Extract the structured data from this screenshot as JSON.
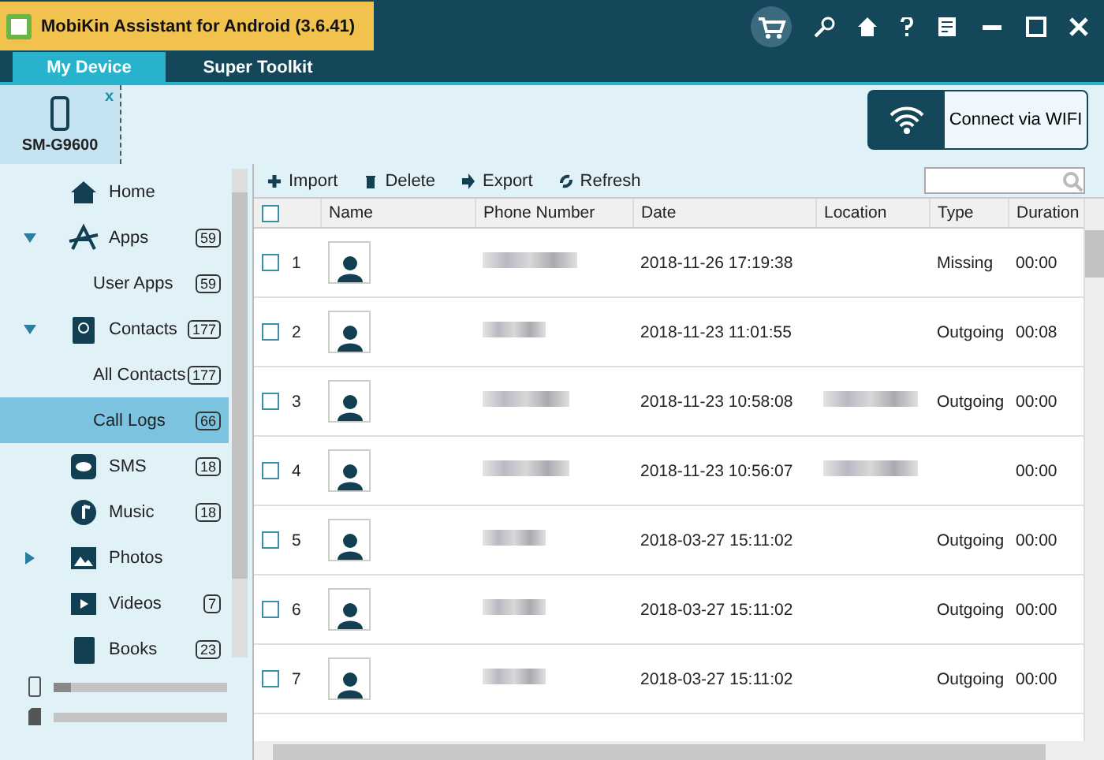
{
  "window": {
    "title": "MobiKin Assistant for Android (3.6.41)"
  },
  "tabs": [
    {
      "label": "My Device",
      "selected": true
    },
    {
      "label": "Super Toolkit",
      "selected": false
    }
  ],
  "device": {
    "name": "SM-G9600",
    "close": "x"
  },
  "wifi_button": {
    "label": "Connect via WIFI"
  },
  "sidebar": {
    "items": [
      {
        "label": "Home",
        "kind": "main",
        "selected": false
      },
      {
        "label": "Apps",
        "kind": "main",
        "count": "59",
        "expanded": true,
        "selected": false
      },
      {
        "label": "User Apps",
        "kind": "sub",
        "count": "59",
        "selected": false
      },
      {
        "label": "Contacts",
        "kind": "main",
        "count": "177",
        "expanded": true,
        "selected": false
      },
      {
        "label": "All Contacts",
        "kind": "sub",
        "count": "177",
        "selected": false
      },
      {
        "label": "Call Logs",
        "kind": "sub",
        "count": "66",
        "selected": true
      },
      {
        "label": "SMS",
        "kind": "main",
        "count": "18",
        "selected": false
      },
      {
        "label": "Music",
        "kind": "main",
        "count": "18",
        "selected": false
      },
      {
        "label": "Photos",
        "kind": "main",
        "expanded": false,
        "selected": false
      },
      {
        "label": "Videos",
        "kind": "main",
        "count": "7",
        "selected": false
      },
      {
        "label": "Books",
        "kind": "main",
        "count": "23",
        "selected": false
      }
    ],
    "storage": [
      {
        "kind": "phone",
        "level": 0.1
      },
      {
        "kind": "sd_card"
      }
    ]
  },
  "toolbar": [
    "Import",
    "Delete",
    "Export",
    "Refresh"
  ],
  "table": {
    "columns": [
      "Name",
      "Phone Number",
      "Date",
      "Location",
      "Type",
      "Duration"
    ],
    "all_checked": false,
    "rows": [
      {
        "index": "1",
        "checked": false,
        "date": "2018-11-26 17:19:38",
        "location_redacted": false,
        "type": "Missing",
        "duration": "00:00"
      },
      {
        "index": "2",
        "checked": false,
        "date": "2018-11-23 11:01:55",
        "location_redacted": false,
        "type": "Outgoing",
        "duration": "00:08"
      },
      {
        "index": "3",
        "checked": false,
        "date": "2018-11-23 10:58:08",
        "location_redacted": true,
        "type": "Outgoing",
        "duration": "00:00"
      },
      {
        "index": "4",
        "checked": false,
        "date": "2018-11-23 10:56:07",
        "location_redacted": true,
        "duration": "00:00"
      },
      {
        "index": "5",
        "checked": false,
        "date": "2018-03-27 15:11:02",
        "location_redacted": false,
        "type": "Outgoing",
        "duration": "00:00"
      },
      {
        "index": "6",
        "checked": false,
        "date": "2018-03-27 15:11:02",
        "location_redacted": false,
        "type": "Outgoing",
        "duration": "00:00"
      },
      {
        "index": "7",
        "checked": false,
        "date": "2018-03-27 15:11:02",
        "location_redacted": false,
        "type": "Outgoing",
        "duration": "00:00"
      }
    ]
  }
}
